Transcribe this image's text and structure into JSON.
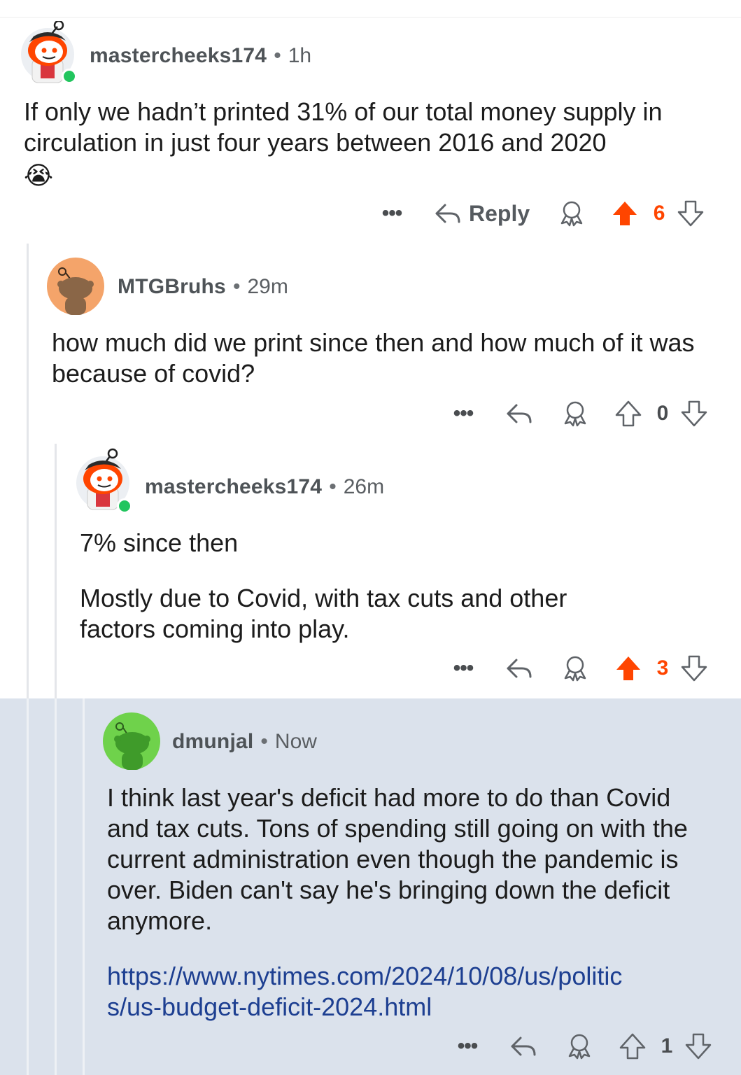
{
  "colors": {
    "upvote_active": "#ff4500",
    "highlight_bg": "#dbe2ec",
    "link": "#1d3f91",
    "online": "#22c55e"
  },
  "comments": [
    {
      "username": "mastercheeks174",
      "time": "1h",
      "body": [
        "If only we hadn’t printed 31% of our total money supply in circulation in just four years between 2016 and 2020"
      ],
      "emoji": "😭",
      "reply_label": "Reply",
      "votes": "6",
      "upvoted": true,
      "avatar": "snoo-red-hat"
    },
    {
      "username": "MTGBruhs",
      "time": "29m",
      "body": [
        "how much did we print since then and how much of it was because of covid?"
      ],
      "votes": "0",
      "upvoted": false,
      "avatar": "snoo-orange"
    },
    {
      "username": "mastercheeks174",
      "time": "26m",
      "body": [
        "7% since then",
        "Mostly due to Covid, with tax cuts and other factors coming into play."
      ],
      "votes": "3",
      "upvoted": true,
      "avatar": "snoo-red-hat"
    },
    {
      "username": "dmunjal",
      "time": "Now",
      "body": [
        "I think last year's deficit had more to do than Covid and tax cuts.  Tons of spending still going on with the current administration even though the pandemic is over.  Biden can't say he's bringing down the deficit anymore."
      ],
      "link": "https://www.nytimes.com/2024/10/08/us/politics/us-budget-deficit-2024.html",
      "votes": "1",
      "upvoted": false,
      "avatar": "snoo-green"
    }
  ],
  "icons": {
    "more": "more-icon",
    "reply": "reply-arrow-icon",
    "award": "award-icon",
    "upvote": "upvote-arrow-icon",
    "downvote": "downvote-arrow-icon"
  },
  "more_glyph": "•••",
  "separator": "•"
}
